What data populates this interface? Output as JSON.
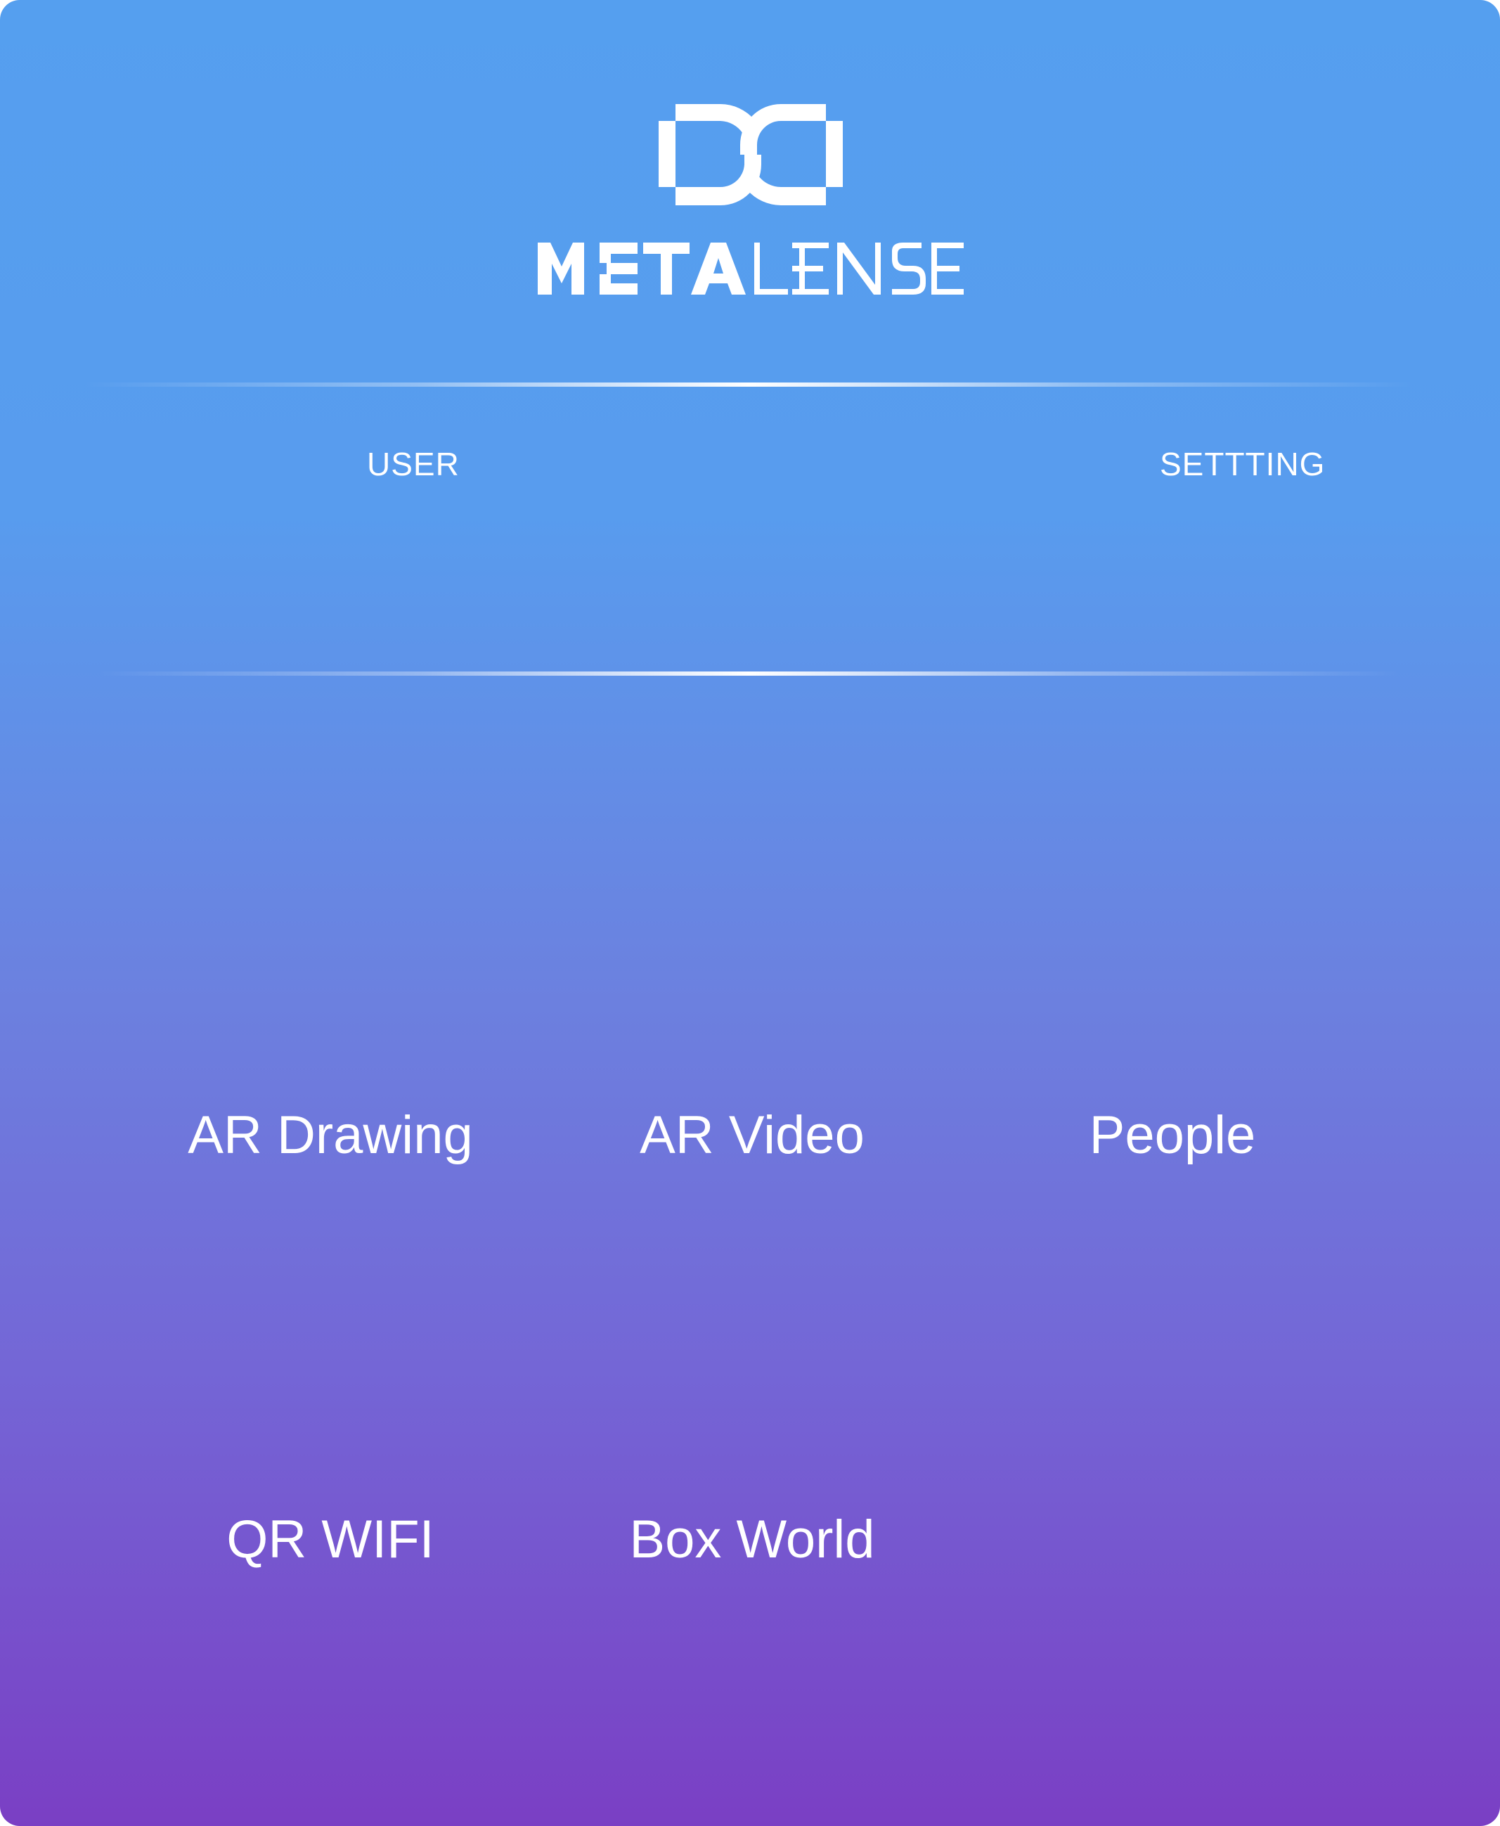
{
  "app": {
    "brand_name": "METALENSE",
    "logo_icon": "metalense-dd-logo-icon"
  },
  "nav": {
    "user_label": "USER",
    "setting_label": "SETTTING"
  },
  "features": [
    {
      "label": "AR Drawing"
    },
    {
      "label": "AR Video"
    },
    {
      "label": "People"
    },
    {
      "label": "QR WIFI"
    },
    {
      "label": "Box World"
    }
  ],
  "colors": {
    "gradient_top": "#559fef",
    "gradient_bottom": "#7a3fc4",
    "text": "#ffffff"
  }
}
